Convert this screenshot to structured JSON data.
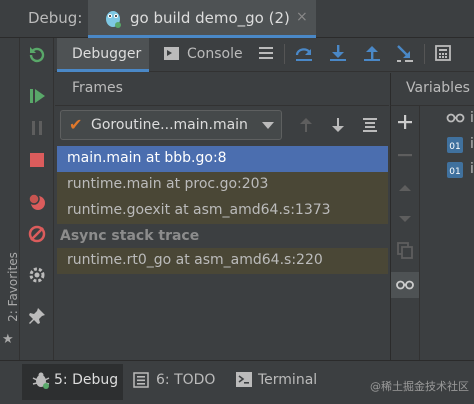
{
  "titlebar": {
    "label": "Debug:",
    "run_tab": "go build demo_go (2)",
    "close": "×"
  },
  "tabs": {
    "debugger": "Debugger",
    "console": "Console"
  },
  "frames": {
    "title": "Frames",
    "goroutine": "Goroutine...main.main",
    "check": "✔",
    "items": [
      "main.main at bbb.go:8",
      "runtime.main at proc.go:203",
      "runtime.goexit at asm_amd64.s:1373"
    ],
    "async_header": "Async stack trace",
    "async_items": [
      "runtime.rt0_go at asm_amd64.s:220"
    ]
  },
  "variables": {
    "title": "Variables",
    "rows": [
      "i",
      "i",
      "i"
    ]
  },
  "favorites": {
    "label": "2: Favorites"
  },
  "bottombar": {
    "debug": "5: Debug",
    "todo": "6: TODO",
    "terminal": "Terminal"
  },
  "watermark": "@稀土掘金技术社区",
  "colors": {
    "accent": "#4a88c7",
    "selected": "#4b6eaf",
    "run_green": "#59a869",
    "stop_red": "#db5c5c",
    "check_orange": "#e0782b"
  }
}
